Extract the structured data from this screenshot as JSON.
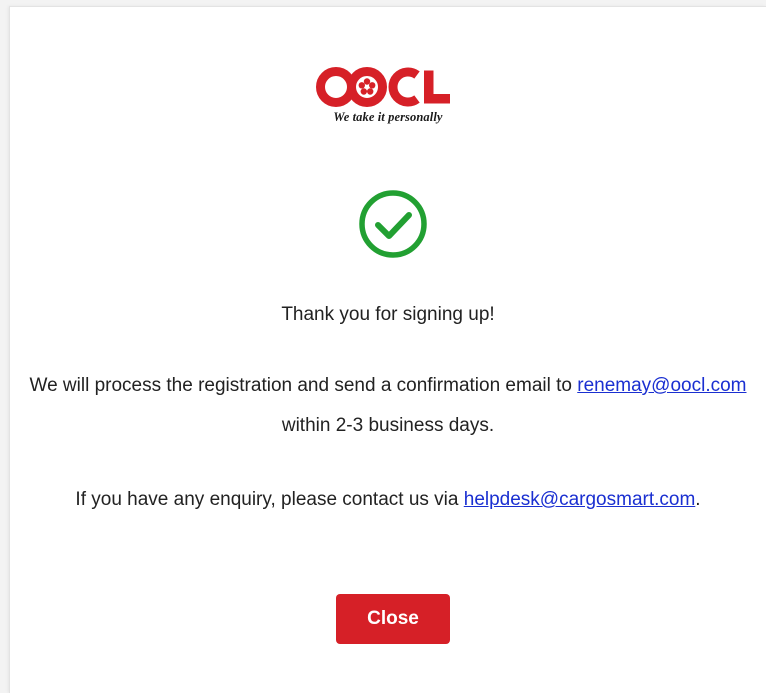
{
  "brand": {
    "logo_text": "OOCL",
    "tagline": "We take it personally",
    "color": "#d62027"
  },
  "status": {
    "icon": "check-circle-icon",
    "color": "#22a032"
  },
  "message": {
    "thanks": "Thank you for signing up!",
    "para1_prefix": "We will process the registration and send a confirmation email to ",
    "email": "renemay@oocl.com",
    "para1_suffix": " within 2-3 business days.",
    "para2_prefix": "If you have any enquiry, please contact us via ",
    "helpdesk_email": "helpdesk@cargosmart.com",
    "para2_suffix": "."
  },
  "actions": {
    "close_label": "Close",
    "close_color": "#d62027",
    "link_color": "#1a2fd1"
  }
}
